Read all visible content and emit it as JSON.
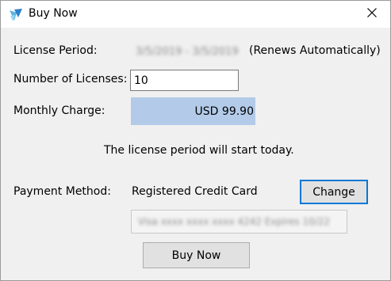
{
  "window": {
    "title": "Buy Now",
    "close_symbol": "✕"
  },
  "fields": {
    "license_period_label": "License Period:",
    "license_period_value": "3/5/2019 - 3/5/2019",
    "renews_note": "(Renews Automatically)",
    "num_licenses_label": "Number of Licenses:",
    "num_licenses_value": "10",
    "monthly_charge_label": "Monthly Charge:",
    "monthly_charge_value": "USD 99.90",
    "notice": "The license period will start today.",
    "payment_method_label": "Payment Method:",
    "payment_method_value": "Registered Credit Card",
    "card_details": "Visa xxxx xxxx xxxx 4242 Expires 10/22"
  },
  "buttons": {
    "change_label": "Change",
    "buy_now_label": "Buy Now"
  },
  "colors": {
    "charge_highlight": "#b3cbe9",
    "focus_border": "#0078d7",
    "button_face": "#e1e1e1"
  },
  "icons": {
    "app": "app-logo-icon",
    "close": "close-icon"
  }
}
